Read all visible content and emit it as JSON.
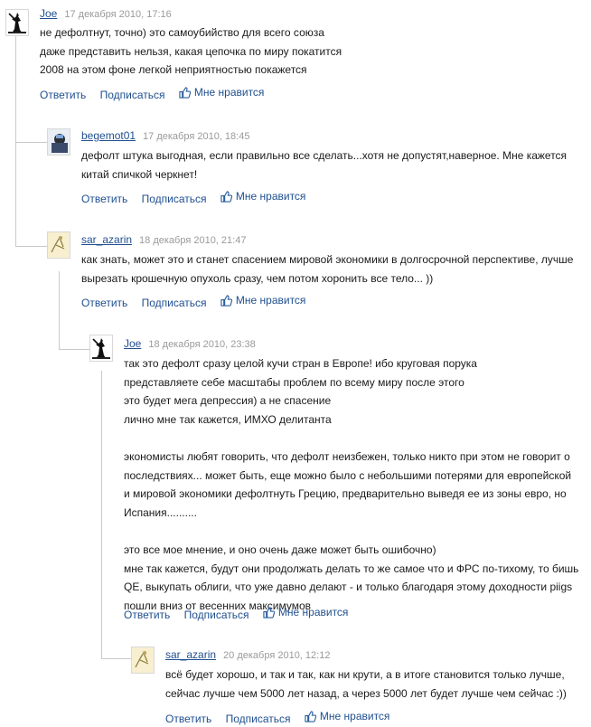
{
  "comments": [
    {
      "author": "Joe",
      "date": "17 декабря 2010, 17:16",
      "lines": [
        "не дефолтнут, точно) это самоубийство для всего союза",
        "даже представить нельзя, какая цепочка по миру покатится",
        "2008 на этом фоне легкой неприятностью покажется"
      ]
    },
    {
      "author": "begemot01",
      "date": "17 декабря 2010, 18:45",
      "lines": [
        "дефолт штука выгодная, если правильно все сделать...хотя не допустят,наверное. Мне кажется",
        "китай спичкой черкнет!"
      ]
    },
    {
      "author": "sar_azarin",
      "date": "18 декабря 2010, 21:47",
      "lines": [
        "как знать, может это и станет спасением мировой экономики в долгосрочной перспективе, лучше",
        "вырезать крошечную опухоль сразу, чем потом хоронить все тело... ))"
      ]
    },
    {
      "author": "Joe",
      "date": "18 декабря 2010, 23:38",
      "lines": [
        "так это дефолт сразу целой кучи стран в Европе! ибо круговая порука",
        "представляете себе масштабы проблем по всему миру после этого",
        "это будет мега депрессия) а не спасение",
        "лично мне так кажется, ИМХО делитанта",
        "",
        "экономисты любят говорить, что дефолт неизбежен, только никто при этом не говорит о",
        "последствиях... может быть, еще можно было с небольшими потерями для европейской",
        "и мировой экономики дефолтнуть Грецию, предварительно выведя ее из зоны евро, но",
        "Испания..........",
        "",
        "это все мое мнение, и оно очень даже может быть ошибочно)",
        "мне так кажется, будут они продолжать делать то же самое что и ФРС по-тихому, то бишь",
        "QE, выкупать облиги, что уже давно делают - и только благодаря этому доходности piigs",
        "пошли вниз от весенних максимумов"
      ]
    },
    {
      "author": "sar_azarin",
      "date": "20 декабря 2010, 12:12",
      "lines": [
        "всё будет хорошо, и так и так, как ни крути, а в итоге становится только лучше,",
        "сейчас лучше чем 5000 лет назад, а через 5000 лет будет лучше чем сейчас :))"
      ]
    }
  ],
  "actions": {
    "reply": "Ответить",
    "subscribe": "Подписаться",
    "like": "Мне нравится"
  },
  "colors": {
    "link": "#1f4f8f",
    "date": "#9a9a9a",
    "thread_line": "#c9c9c9"
  },
  "icons": {
    "like": "thumbs-up-icon",
    "avatar_joe": "silhouette-figure",
    "avatar_begemot": "photo-avatar",
    "avatar_sar": "sketch-avatar"
  }
}
